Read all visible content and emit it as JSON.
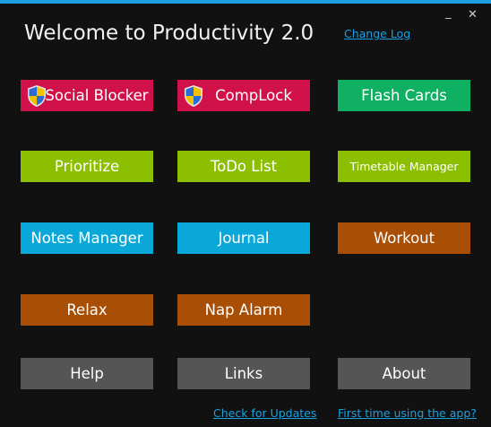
{
  "window": {
    "title": "Welcome to Productivity 2.0",
    "minimize_glyph": "_",
    "close_glyph": "✕",
    "accent_color": "#1ba1e2"
  },
  "links": {
    "change_log": "Change Log",
    "check_updates": "Check for Updates",
    "first_time": "First time using the app?"
  },
  "tiles": [
    {
      "label": "Social Blocker",
      "color": "#d1124a",
      "icon": "uac-shield-icon"
    },
    {
      "label": "CompLock",
      "color": "#d1124a",
      "icon": "uac-shield-icon"
    },
    {
      "label": "Flash Cards",
      "color": "#0fb061"
    },
    {
      "label": "Prioritize",
      "color": "#8cbf00"
    },
    {
      "label": "ToDo List",
      "color": "#8cbf00"
    },
    {
      "label": "Timetable Manager",
      "color": "#8cbf00"
    },
    {
      "label": "Notes Manager",
      "color": "#0aa8d8"
    },
    {
      "label": "Journal",
      "color": "#0aa8d8"
    },
    {
      "label": "Workout",
      "color": "#a84e05"
    },
    {
      "label": "Relax",
      "color": "#a84e05"
    },
    {
      "label": "Nap Alarm",
      "color": "#a84e05"
    },
    {
      "label": "Help",
      "color": "#555555"
    },
    {
      "label": "Links",
      "color": "#555555"
    },
    {
      "label": "About",
      "color": "#555555"
    }
  ]
}
